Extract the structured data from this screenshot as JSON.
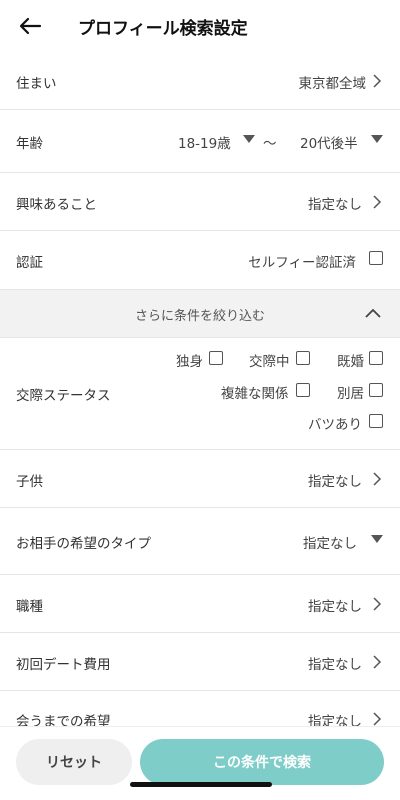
{
  "header": {
    "title": "プロフィール検索設定",
    "back_icon": "arrow-left-icon"
  },
  "residence": {
    "label": "住まい",
    "value": "東京都全域"
  },
  "age": {
    "label": "年齢",
    "from": "18-19歳",
    "separator": "〜",
    "to": "20代後半"
  },
  "interests": {
    "label": "興味あること",
    "value": "指定なし"
  },
  "verification": {
    "label": "認証",
    "option": "セルフィー認証済"
  },
  "more_filters": {
    "label": "さらに条件を絞り込む"
  },
  "relationship": {
    "label": "交際ステータス",
    "options": [
      "独身",
      "交際中",
      "既婚",
      "複雑な関係",
      "別居",
      "バツあり"
    ]
  },
  "children": {
    "label": "子供",
    "value": "指定なし"
  },
  "preferred_type": {
    "label": "お相手の希望のタイプ",
    "value": "指定なし"
  },
  "occupation": {
    "label": "職種",
    "value": "指定なし"
  },
  "first_date_cost": {
    "label": "初回デート費用",
    "value": "指定なし"
  },
  "until_meeting": {
    "label": "会うまでの希望",
    "value": "指定なし"
  },
  "footer": {
    "reset_label": "リセット",
    "search_label": "この条件で検索"
  },
  "colors": {
    "accent": "#7fcdc9",
    "section_bg": "#f2f2f2",
    "divider": "#e6e6e6"
  }
}
